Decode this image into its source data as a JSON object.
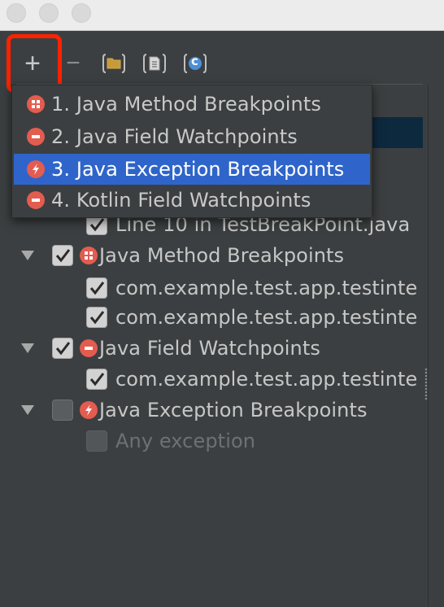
{
  "colors": {
    "highlight": "#ff2200",
    "selection": "#2f65ca",
    "breakpoint_red": "#e35c50",
    "panel": "#3c3f41"
  },
  "toolbar": {
    "add_label": "+",
    "remove_label": "−",
    "group_icon": "folder-icon",
    "file_icon": "file-icon",
    "class_icon": "class-icon",
    "class_letter": "c"
  },
  "add_menu": {
    "items": [
      {
        "label": "1. Java Method Breakpoints",
        "icon": "method-breakpoint-icon",
        "selected": false
      },
      {
        "label": "2. Java Field Watchpoints",
        "icon": "field-watchpoint-icon",
        "selected": false
      },
      {
        "label": "3. Java Exception Breakpoints",
        "icon": "exception-breakpoint-icon",
        "selected": true
      },
      {
        "label": "4. Kotlin Field Watchpoints",
        "icon": "field-watchpoint-icon",
        "selected": false
      }
    ]
  },
  "tree": {
    "line_breakpoint": {
      "label": "Line 10 in TestBreakPoint.java",
      "checked": true
    },
    "method_group": {
      "label": "Java Method Breakpoints",
      "checked": true,
      "expanded": true,
      "children": [
        {
          "label": "com.example.test.app.testinte",
          "checked": true
        },
        {
          "label": "com.example.test.app.testinte",
          "checked": true
        }
      ]
    },
    "field_group": {
      "label": "Java Field Watchpoints",
      "checked": true,
      "expanded": true,
      "children": [
        {
          "label": "com.example.test.app.testinte",
          "checked": true
        }
      ]
    },
    "exception_group": {
      "label": "Java Exception Breakpoints",
      "checked": false,
      "expanded": true,
      "children": [
        {
          "label": "Any exception",
          "checked": false,
          "disabled": true
        }
      ]
    }
  }
}
